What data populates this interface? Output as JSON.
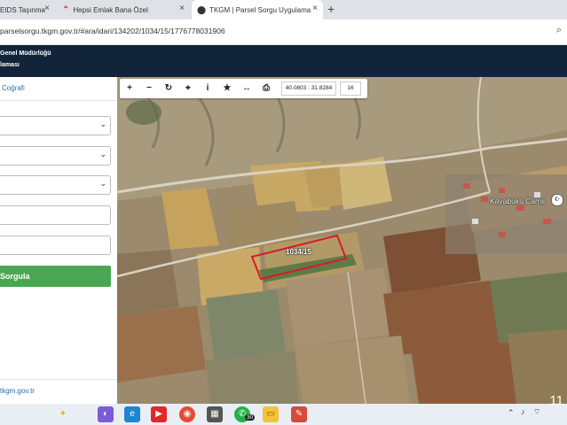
{
  "browser": {
    "tabs": [
      {
        "label": "EIDS Taşınma",
        "close": "×"
      },
      {
        "label": "Hepsi Emlak Bana Özel",
        "close": "×"
      },
      {
        "label": "TKGM | Parsel Sorgu Uygulama",
        "close": "×"
      }
    ],
    "new_tab": "+",
    "url": "parselsorgu.tkgm.gov.tr/#ara/idari/134202/1034/15/1776778031906"
  },
  "site": {
    "header_line1": "Genel Müdürlüğü",
    "header_line2": "laması"
  },
  "left_panel": {
    "tab_label": "Coğrafi",
    "selects": [
      "",
      "",
      ""
    ],
    "inputs": [
      "",
      ""
    ],
    "query_button": "Sorgula",
    "footer_link": "tkgm.gov.tr"
  },
  "map": {
    "toolbar": {
      "zoom_in": "+",
      "zoom_out": "−",
      "refresh": "↻",
      "locate": "⌖",
      "info": "i",
      "favorite": "★",
      "measure": "↔",
      "print": "⎙",
      "coordinates": "40.0803 : 31.8284",
      "zoom_level": "16"
    },
    "parcel_label": "1034/15",
    "poi_label": "Kayabükü Camii",
    "colors": {
      "parcel_outline": "#d61a2a"
    }
  },
  "taskbar": {
    "clock": "11",
    "icons": [
      "sparkle-icon",
      "copilot-icon",
      "edge-icon",
      "youtube-icon",
      "chrome-icon",
      "calculator-icon",
      "whatsapp-icon",
      "files-icon",
      "paint-icon"
    ],
    "whatsapp_badge": "30"
  }
}
